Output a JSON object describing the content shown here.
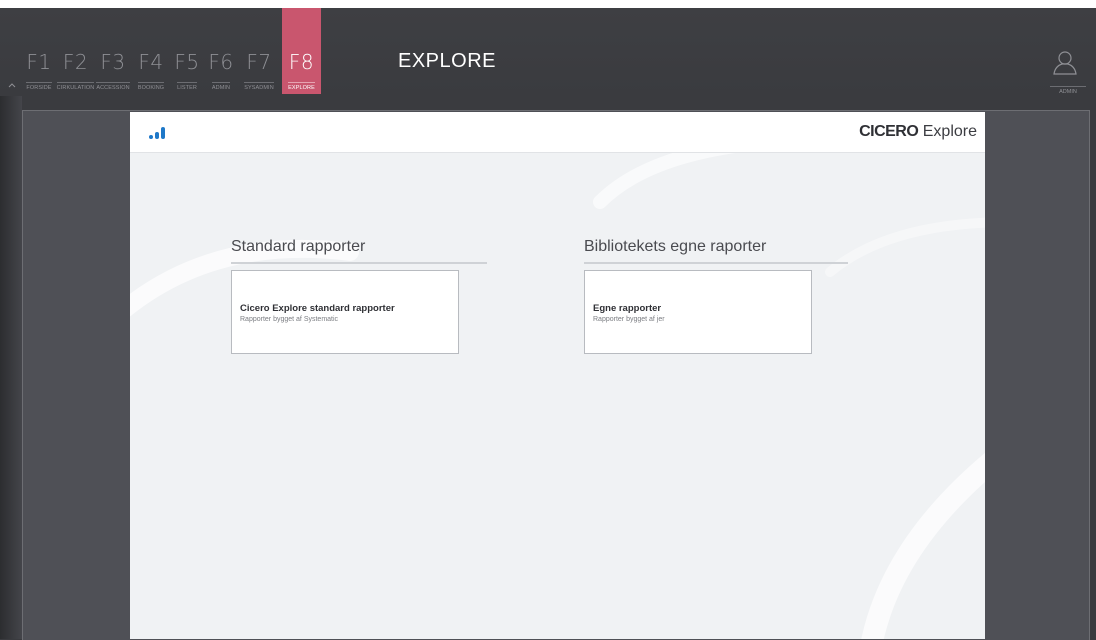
{
  "navbar": {
    "fkeys": [
      {
        "key": "F1",
        "label": "FORSIDE",
        "active": false
      },
      {
        "key": "F2",
        "label": "CIRKULATION",
        "active": false
      },
      {
        "key": "F3",
        "label": "ACCESSION",
        "active": false
      },
      {
        "key": "F4",
        "label": "BOOKING",
        "active": false
      },
      {
        "key": "F5",
        "label": "LISTER",
        "active": false
      },
      {
        "key": "F6",
        "label": "ADMIN",
        "active": false
      },
      {
        "key": "F7",
        "label": "SYSADMIN",
        "active": false
      },
      {
        "key": "F8",
        "label": "EXPLORE",
        "active": true
      }
    ],
    "module_title": "EXPLORE",
    "user_label": "ADMIN",
    "active_color": "#c9566e"
  },
  "panel": {
    "brand_strong": "CICERO",
    "brand_light": "Explore",
    "accent_color": "#1e78c8"
  },
  "sections": {
    "standard": {
      "title": "Standard rapporter",
      "card_title": "Cicero Explore standard rapporter",
      "card_sub": "Rapporter bygget af Systematic"
    },
    "library": {
      "title": "Bibliotekets egne raporter",
      "card_title": "Egne rapporter",
      "card_sub": "Rapporter bygget af jer"
    }
  }
}
